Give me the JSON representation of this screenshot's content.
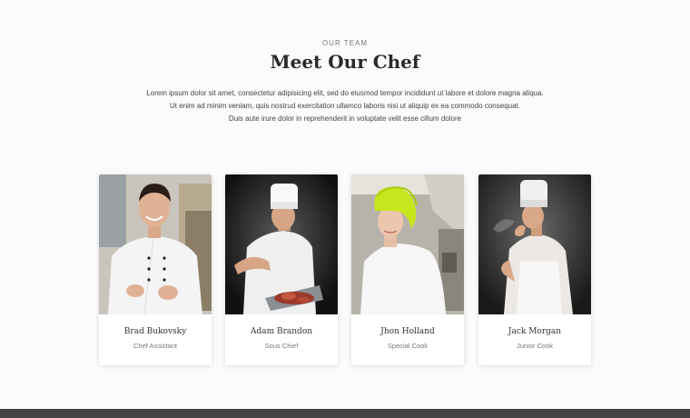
{
  "section": {
    "eyebrow": "OUR TEAM",
    "title": "Meet Our Chef",
    "intro_lines": [
      "Lorem ipsum dolor sit amet, consectetur adipisicing elit, sed do eiusmod tempor incididunt ut labore et dolore magna aliqua.",
      "Ut enim ad minim veniam, quis nostrud exercitation ullamco laboris nisi ut aliquip ex ea commodo consequat.",
      "Duis aute irure dolor in reprehenderit in voluptate velit esse cillum dolore"
    ]
  },
  "chefs": [
    {
      "name": "Brad Bukovsky",
      "role": "Chef Assistant"
    },
    {
      "name": "Adam Brandon",
      "role": "Sous Chief"
    },
    {
      "name": "Jhon Holland",
      "role": "Special Cook"
    },
    {
      "name": "Jack Morgan",
      "role": "Junior Cook"
    }
  ],
  "colors": {
    "background": "#fbfbfb",
    "title": "#2a2a2a",
    "footer": "#444444",
    "hat_green": "#c8e61e"
  }
}
